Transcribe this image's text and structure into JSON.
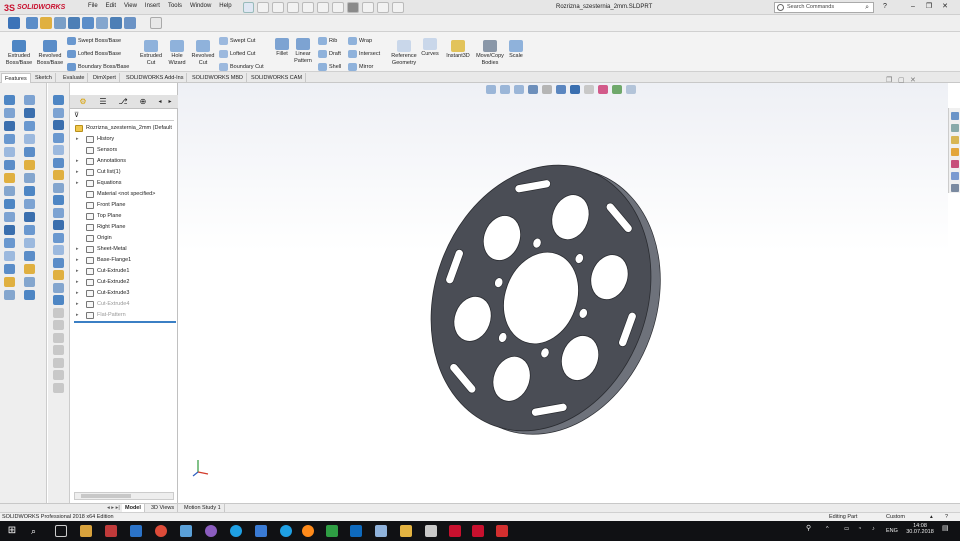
{
  "app": {
    "logo_text": "SOLIDWORKS",
    "menus": [
      "File",
      "Edit",
      "View",
      "Insert",
      "Tools",
      "Window",
      "Help"
    ],
    "document_title": "Rozrizna_szesternia_2mm.SLDPRT",
    "search_placeholder": "Search Commands"
  },
  "command_manager": {
    "features": [
      {
        "label": "Extruded Boss/Base",
        "icon": "extruded-boss-icon"
      },
      {
        "label": "Revolved Boss/Base",
        "icon": "revolved-boss-icon"
      },
      {
        "label": "Extruded Cut",
        "icon": "extruded-cut-icon"
      },
      {
        "label": "Hole Wizard",
        "icon": "hole-wizard-icon"
      },
      {
        "label": "Revolved Cut",
        "icon": "revolved-cut-icon"
      },
      {
        "label": "Fillet",
        "icon": "fillet-icon"
      },
      {
        "label": "Linear Pattern",
        "icon": "linear-pattern-icon"
      },
      {
        "label": "Reference Geometry",
        "icon": "reference-geometry-icon"
      },
      {
        "label": "Curves",
        "icon": "curves-icon"
      },
      {
        "label": "Instant3D",
        "icon": "instant3d-icon"
      },
      {
        "label": "Move/Copy Bodies",
        "icon": "move-copy-icon"
      },
      {
        "label": "Scale",
        "icon": "scale-icon"
      }
    ],
    "small": {
      "swept_boss": "Swept Boss/Base",
      "lofted_boss": "Lofted Boss/Base",
      "boundary_boss": "Boundary Boss/Base",
      "swept_cut": "Swept Cut",
      "lofted_cut": "Lofted Cut",
      "boundary_cut": "Boundary Cut",
      "rib": "Rib",
      "draft": "Draft",
      "shell": "Shell",
      "wrap": "Wrap",
      "intersect": "Intersect",
      "mirror": "Mirror"
    }
  },
  "tabs": [
    "Features",
    "Sketch",
    "Evaluate",
    "DimXpert",
    "SOLIDWORKS Add-Ins",
    "SOLIDWORKS MBD",
    "SOLIDWORKS CAM"
  ],
  "feature_tree": {
    "root": "Rozrizna_szesternia_2mm  (Default",
    "items": [
      {
        "label": "History",
        "arrow": "▸",
        "dim": false
      },
      {
        "label": "Sensors",
        "arrow": "",
        "dim": false
      },
      {
        "label": "Annotations",
        "arrow": "▸",
        "dim": false
      },
      {
        "label": "Cut list(1)",
        "arrow": "▸",
        "dim": false
      },
      {
        "label": "Equations",
        "arrow": "▸",
        "dim": false
      },
      {
        "label": "Material <not specified>",
        "arrow": "",
        "dim": false
      },
      {
        "label": "Front Plane",
        "arrow": "",
        "dim": false
      },
      {
        "label": "Top Plane",
        "arrow": "",
        "dim": false
      },
      {
        "label": "Right Plane",
        "arrow": "",
        "dim": false
      },
      {
        "label": "Origin",
        "arrow": "",
        "dim": false
      },
      {
        "label": "Sheet-Metal",
        "arrow": "▸",
        "dim": false
      },
      {
        "label": "Base-Flange1",
        "arrow": "▸",
        "dim": false
      },
      {
        "label": "Cut-Extrude1",
        "arrow": "▸",
        "dim": false
      },
      {
        "label": "Cut-Extrude2",
        "arrow": "▸",
        "dim": false
      },
      {
        "label": "Cut-Extrude3",
        "arrow": "▸",
        "dim": false
      },
      {
        "label": "Cut-Extrude4",
        "arrow": "▸",
        "dim": true
      },
      {
        "label": "Flat-Pattern",
        "arrow": "▸",
        "dim": true
      }
    ]
  },
  "bottom_tabs": [
    "Model",
    "3D Views",
    "Motion Study 1"
  ],
  "status": {
    "edition": "SOLIDWORKS Professional 2018 x64 Edition",
    "mode": "Editing Part",
    "units": "Custom"
  },
  "taskbar": {
    "language": "ENG",
    "time": "14:08",
    "date": "30.07.2018"
  },
  "colors": {
    "part_face": "#4a4d55",
    "part_edge": "#2a2c31",
    "part_side": "#6e727b",
    "brand_red": "#c8102e",
    "rollback_bar": "#3b7fc4"
  }
}
